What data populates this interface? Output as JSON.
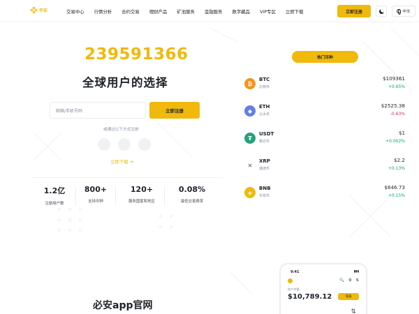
{
  "header": {
    "logo_text": "币安",
    "nav": [
      "交易中心",
      "行情分析",
      "合约交易",
      "理财产品",
      "矿池服务",
      "金融服务",
      "数字藏品",
      "VIP专区",
      "立即下载"
    ],
    "register_label": "立即注册",
    "lang_label": "中文"
  },
  "hero": {
    "user_count": "239591366",
    "title": "全球用户的选择",
    "email_placeholder": "邮箱/手机号码",
    "signup_label": "立即注册",
    "or_text": "或通过以下方式注册",
    "download_label": "立即下载",
    "download_arrow": "➔"
  },
  "stats": [
    {
      "value": "1.2亿",
      "label": "注册用户数"
    },
    {
      "value": "800+",
      "label": "支持币种"
    },
    {
      "value": "120+",
      "label": "服务国家和地区"
    },
    {
      "value": "0.08%",
      "label": "最低交易费率"
    }
  ],
  "market": {
    "popular_label": "热门币种",
    "coins": [
      {
        "symbol": "BTC",
        "name": "比特币",
        "price": "$109361",
        "change": "+0.65%",
        "direction": "up",
        "icon": "bitcoin-icon",
        "glyph": "₿",
        "color": "#f7931a"
      },
      {
        "symbol": "ETH",
        "name": "以太坊",
        "price": "$2525.38",
        "change": "-0.63%",
        "direction": "down",
        "icon": "ethereum-icon",
        "glyph": "◆",
        "color": "#627eea"
      },
      {
        "symbol": "USDT",
        "name": "泰达币",
        "price": "$1",
        "change": "+0.002%",
        "direction": "up",
        "icon": "tether-icon",
        "glyph": "₮",
        "color": "#26a17b"
      },
      {
        "symbol": "XRP",
        "name": "瑞波币",
        "price": "$2.2",
        "change": "+0.13%",
        "direction": "up",
        "icon": "xrp-icon",
        "glyph": "✕",
        "color": "#ffffff"
      },
      {
        "symbol": "BNB",
        "name": "币安币",
        "price": "$646.73",
        "change": "+0.15%",
        "direction": "up",
        "icon": "bnb-icon",
        "glyph": "◈",
        "color": "#f0b90b"
      }
    ]
  },
  "app_section": {
    "title": "必安app官网",
    "phone_time": "9:41",
    "phone_label": "账户余额",
    "phone_balance": "$10,789.12",
    "phone_button": "充值",
    "phone_icons": "🔍 ⚙ ⇅"
  },
  "colors": {
    "accent": "#f0b90b",
    "up": "#03a66d",
    "down": "#cf304a"
  }
}
